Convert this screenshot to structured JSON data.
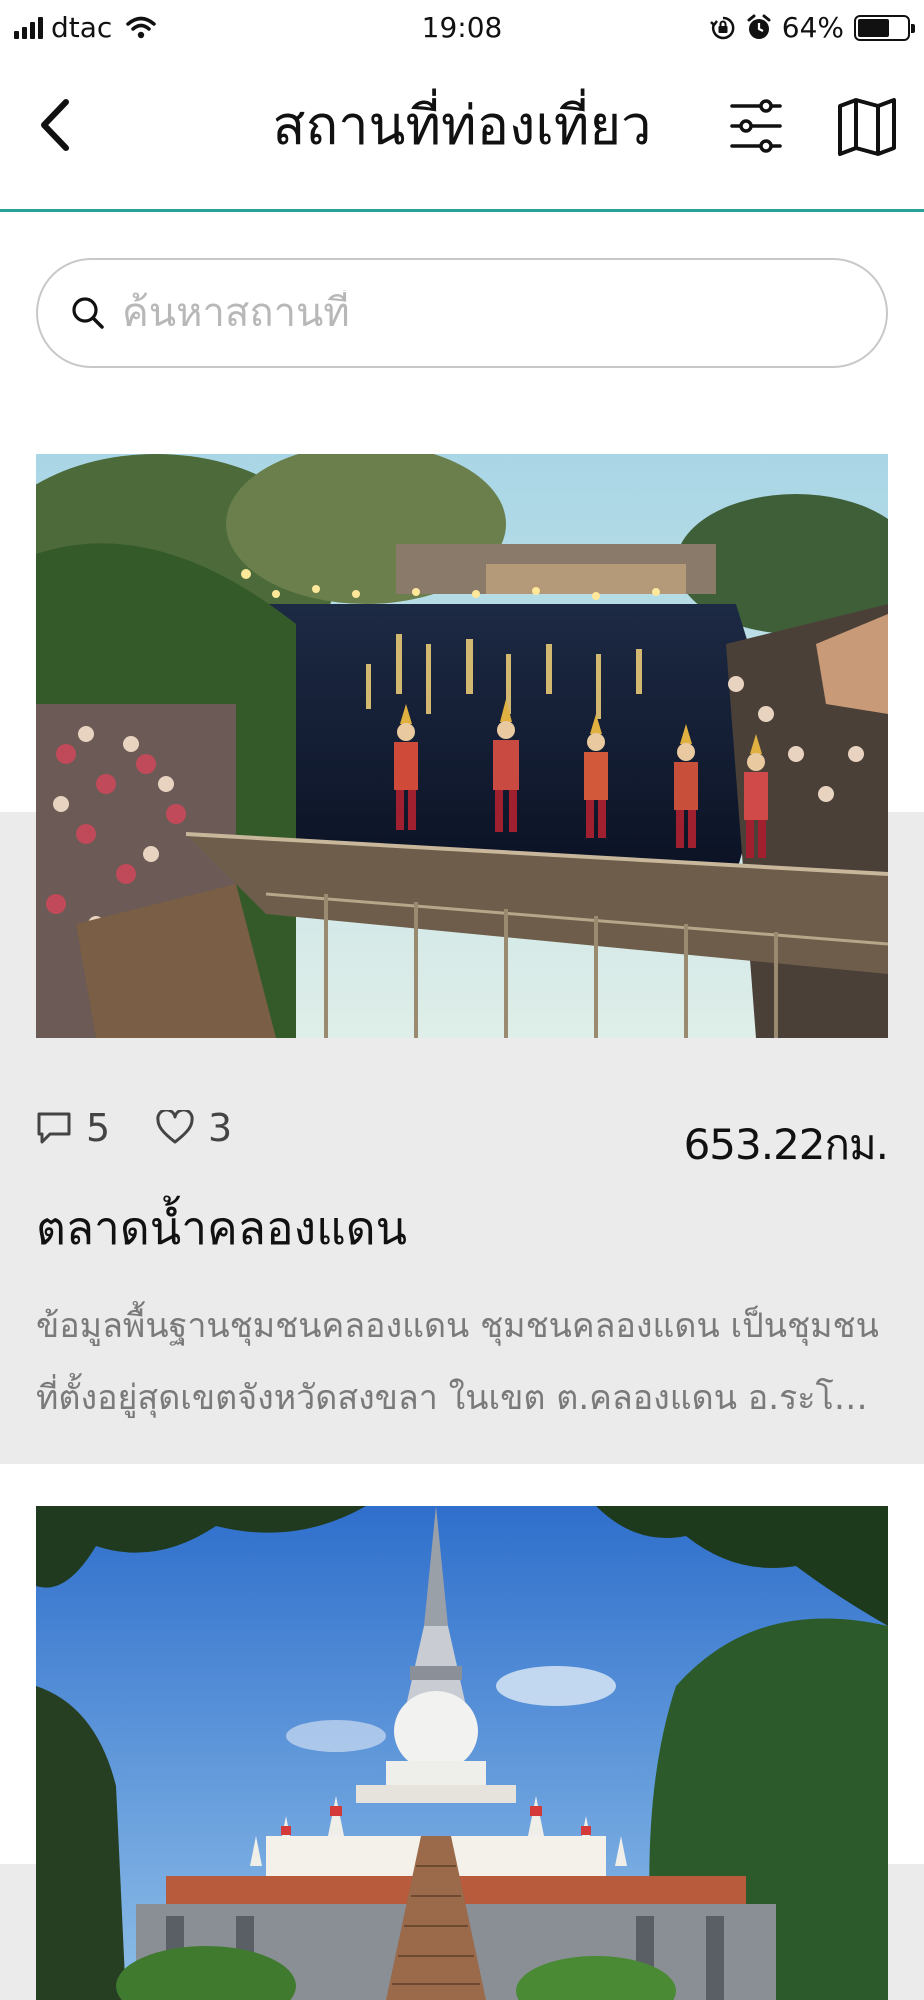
{
  "status_bar": {
    "carrier": "dtac",
    "time": "19:08",
    "battery_percent": "64%",
    "battery_level": 0.64,
    "icons": [
      "signal-icon",
      "wifi-icon",
      "orientation-lock-icon",
      "alarm-icon",
      "battery-icon"
    ]
  },
  "nav": {
    "title": "สถานที่ท่องเที่ยว",
    "back_icon": "chevron-left-icon",
    "filter_icon": "sliders-icon",
    "map_icon": "map-icon",
    "accent_color": "#2aa197"
  },
  "search": {
    "placeholder": "ค้นหาสถานที่",
    "value": ""
  },
  "places": [
    {
      "image_alt": "floating market at dusk with dancers on a wooden bridge",
      "comments": "5",
      "likes": "3",
      "distance": "653.22กม.",
      "title": "ตลาดน้ำคลองแดน",
      "description": "ข้อมูลพื้นฐานชุมชนคลองแดน ชุมชนคลองแดน เป็นชุมชนที่ตั้งอยู่สุดเขตจังหวัดสงขลา ในเขต ต.คลองแดน อ.ระโนด และต่อเนื่องกับ ต...."
    },
    {
      "image_alt": "white pagoda temple under blue sky"
    }
  ]
}
